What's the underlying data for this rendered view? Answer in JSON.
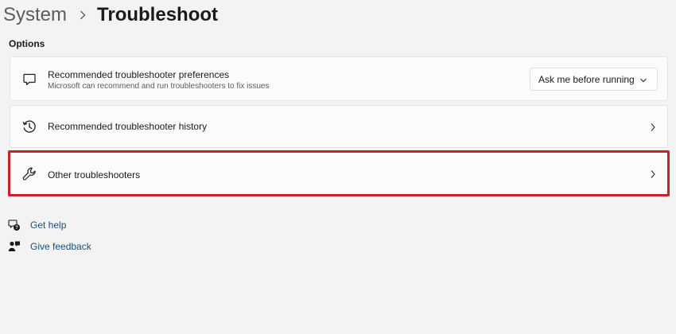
{
  "breadcrumb": {
    "parent": "System",
    "current": "Troubleshoot"
  },
  "section": {
    "title": "Options"
  },
  "cards": {
    "preferences": {
      "title": "Recommended troubleshooter preferences",
      "subtitle": "Microsoft can recommend and run troubleshooters to fix issues",
      "dropdown_value": "Ask me before running",
      "icon": "chat-bubble-icon"
    },
    "history": {
      "title": "Recommended troubleshooter history",
      "icon": "history-icon"
    },
    "other": {
      "title": "Other troubleshooters",
      "icon": "wrench-icon",
      "highlight_color": "#c4232e"
    }
  },
  "links": {
    "help": {
      "label": "Get help",
      "icon": "help-icon"
    },
    "feedback": {
      "label": "Give feedback",
      "icon": "feedback-icon"
    }
  },
  "colors": {
    "background": "#f3f3f3",
    "card": "#fbfbfb",
    "link": "#1a4f7a",
    "highlight": "#c4232e"
  }
}
